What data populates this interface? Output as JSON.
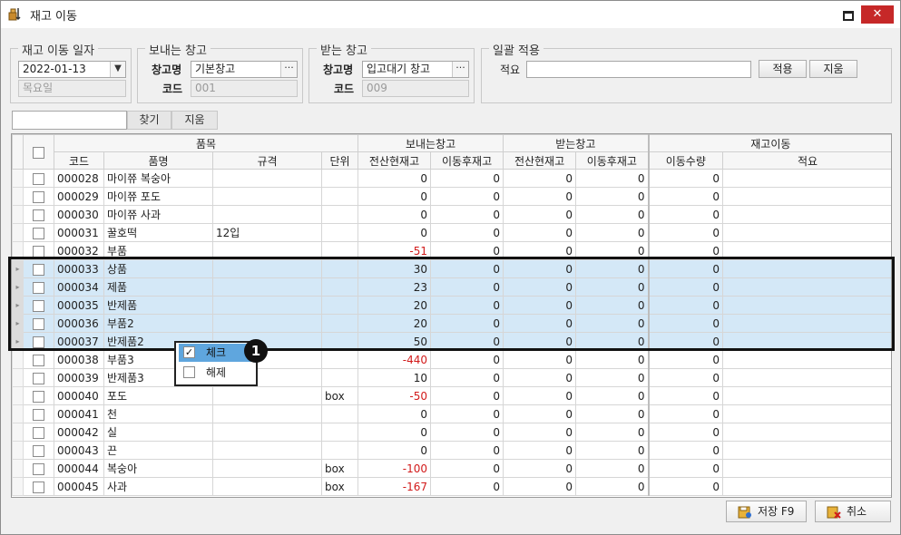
{
  "window": {
    "title": "재고 이동",
    "close_label": "✕"
  },
  "groups": {
    "date": {
      "legend": "재고 이동 일자",
      "date_value": "2022-01-13",
      "weekday": "목요일"
    },
    "send": {
      "legend": "보내는 창고",
      "name_label": "창고명",
      "name_value": "기본창고",
      "code_label": "코드",
      "code_value": "001",
      "browse": "···"
    },
    "recv": {
      "legend": "받는 창고",
      "name_label": "창고명",
      "name_value": "입고대기 창고",
      "code_label": "코드",
      "code_value": "009",
      "browse": "···"
    },
    "bulk": {
      "legend": "일괄 적용",
      "memo_label": "적요",
      "memo_value": "",
      "apply_label": "적용",
      "clear_label": "지움"
    }
  },
  "search": {
    "value": "",
    "find_label": "찾기",
    "clear_label": "지움"
  },
  "grid": {
    "groups": {
      "item": "품목",
      "send": "보내는창고",
      "recv": "받는창고",
      "move": "재고이동"
    },
    "cols": {
      "code": "코드",
      "name": "품명",
      "spec": "규격",
      "unit": "단위",
      "send_cur": "전산현재고",
      "send_after": "이동후재고",
      "recv_cur": "전산현재고",
      "recv_after": "이동후재고",
      "qty": "이동수량",
      "memo": "적요"
    },
    "rows": [
      {
        "code": "000028",
        "name": "마이쮸 복숭아",
        "spec": "",
        "unit": "",
        "send_cur": "0",
        "send_after": "0",
        "recv_cur": "0",
        "recv_after": "0",
        "qty": "0",
        "memo": ""
      },
      {
        "code": "000029",
        "name": "마이쮸 포도",
        "spec": "",
        "unit": "",
        "send_cur": "0",
        "send_after": "0",
        "recv_cur": "0",
        "recv_after": "0",
        "qty": "0",
        "memo": ""
      },
      {
        "code": "000030",
        "name": "마이쮸 사과",
        "spec": "",
        "unit": "",
        "send_cur": "0",
        "send_after": "0",
        "recv_cur": "0",
        "recv_after": "0",
        "qty": "0",
        "memo": ""
      },
      {
        "code": "000031",
        "name": "꿀호떡",
        "spec": "12입",
        "unit": "",
        "send_cur": "0",
        "send_after": "0",
        "recv_cur": "0",
        "recv_after": "0",
        "qty": "0",
        "memo": ""
      },
      {
        "code": "000032",
        "name": "부품",
        "spec": "",
        "unit": "",
        "send_cur": "-51",
        "send_after": "0",
        "recv_cur": "0",
        "recv_after": "0",
        "qty": "0",
        "memo": ""
      },
      {
        "code": "000033",
        "name": "상품",
        "spec": "",
        "unit": "",
        "send_cur": "30",
        "send_after": "0",
        "recv_cur": "0",
        "recv_after": "0",
        "qty": "0",
        "memo": ""
      },
      {
        "code": "000034",
        "name": "제품",
        "spec": "",
        "unit": "",
        "send_cur": "23",
        "send_after": "0",
        "recv_cur": "0",
        "recv_after": "0",
        "qty": "0",
        "memo": ""
      },
      {
        "code": "000035",
        "name": "반제품",
        "spec": "",
        "unit": "",
        "send_cur": "20",
        "send_after": "0",
        "recv_cur": "0",
        "recv_after": "0",
        "qty": "0",
        "memo": ""
      },
      {
        "code": "000036",
        "name": "부품2",
        "spec": "",
        "unit": "",
        "send_cur": "20",
        "send_after": "0",
        "recv_cur": "0",
        "recv_after": "0",
        "qty": "0",
        "memo": ""
      },
      {
        "code": "000037",
        "name": "반제품2",
        "spec": "",
        "unit": "",
        "send_cur": "50",
        "send_after": "0",
        "recv_cur": "0",
        "recv_after": "0",
        "qty": "0",
        "memo": ""
      },
      {
        "code": "000038",
        "name": "부품3",
        "spec": "",
        "unit": "",
        "send_cur": "-440",
        "send_after": "0",
        "recv_cur": "0",
        "recv_after": "0",
        "qty": "0",
        "memo": ""
      },
      {
        "code": "000039",
        "name": "반제품3",
        "spec": "",
        "unit": "",
        "send_cur": "10",
        "send_after": "0",
        "recv_cur": "0",
        "recv_after": "0",
        "qty": "0",
        "memo": ""
      },
      {
        "code": "000040",
        "name": "포도",
        "spec": "",
        "unit": "box",
        "send_cur": "-50",
        "send_after": "0",
        "recv_cur": "0",
        "recv_after": "0",
        "qty": "0",
        "memo": ""
      },
      {
        "code": "000041",
        "name": "천",
        "spec": "",
        "unit": "",
        "send_cur": "0",
        "send_after": "0",
        "recv_cur": "0",
        "recv_after": "0",
        "qty": "0",
        "memo": ""
      },
      {
        "code": "000042",
        "name": "실",
        "spec": "",
        "unit": "",
        "send_cur": "0",
        "send_after": "0",
        "recv_cur": "0",
        "recv_after": "0",
        "qty": "0",
        "memo": ""
      },
      {
        "code": "000043",
        "name": "끈",
        "spec": "",
        "unit": "",
        "send_cur": "0",
        "send_after": "0",
        "recv_cur": "0",
        "recv_after": "0",
        "qty": "0",
        "memo": ""
      },
      {
        "code": "000044",
        "name": "복숭아",
        "spec": "",
        "unit": "box",
        "send_cur": "-100",
        "send_after": "0",
        "recv_cur": "0",
        "recv_after": "0",
        "qty": "0",
        "memo": ""
      },
      {
        "code": "000045",
        "name": "사과",
        "spec": "",
        "unit": "box",
        "send_cur": "-167",
        "send_after": "0",
        "recv_cur": "0",
        "recv_after": "0",
        "qty": "0",
        "memo": ""
      }
    ]
  },
  "context_menu": {
    "check_label": "체크",
    "uncheck_label": "해제",
    "check_mark": "✓",
    "badge": "1"
  },
  "footer": {
    "save_label": "저장 F9",
    "cancel_label": "취소"
  },
  "colors": {
    "selected_row": "#d4e8f7",
    "menu_highlight": "#5fa6de",
    "negative": "#d21b1b",
    "close_button": "#c62828"
  }
}
